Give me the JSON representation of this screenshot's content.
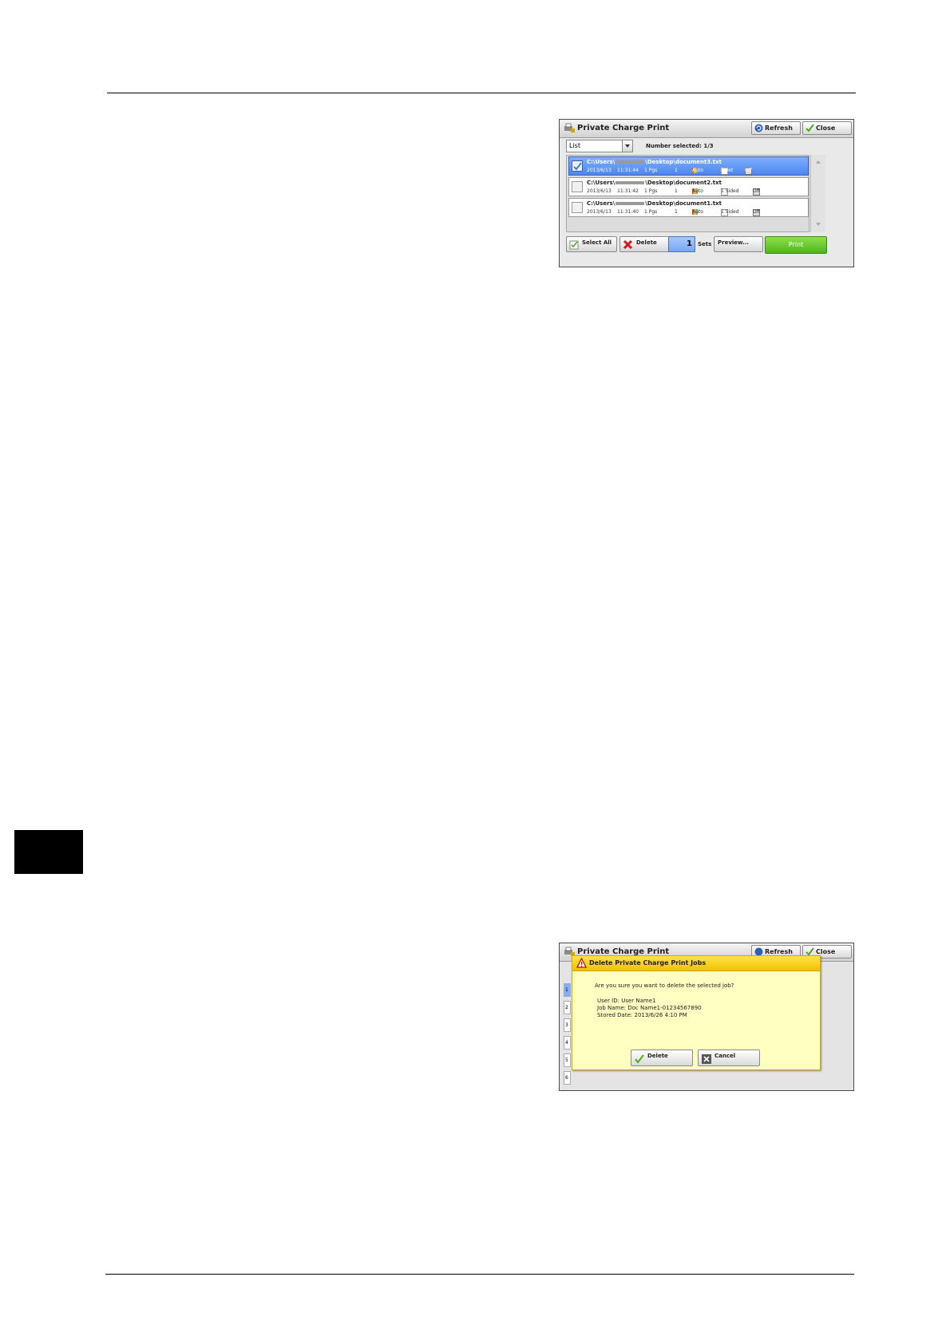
{
  "screen1": {
    "title": "Private Charge Print",
    "refresh_label": "Refresh",
    "close_label": "Close",
    "view_select": "List",
    "number_selected": "Number selected: 1/3",
    "jobs": [
      {
        "path_prefix": "C:\\Users\\",
        "path_suffix": "\\Desktop\\document3.txt",
        "date": "2013/6/13",
        "time": "11:31:44",
        "pages": "1 Pgs",
        "copies": "1",
        "color": "Auto",
        "sides": "Bklet",
        "staple": "Off",
        "selected": true
      },
      {
        "path_prefix": "C:\\Users\\",
        "path_suffix": "\\Desktop\\document2.txt",
        "date": "2013/6/13",
        "time": "11:31:42",
        "pages": "1 Pgs",
        "copies": "1",
        "color": "Auto",
        "sides": "1 Sided",
        "staple": "Off",
        "selected": false
      },
      {
        "path_prefix": "C:\\Users\\",
        "path_suffix": "\\Desktop\\document1.txt",
        "date": "2013/6/13",
        "time": "11:31:40",
        "pages": "1 Pgs",
        "copies": "1",
        "color": "Auto",
        "sides": "1 Sided",
        "staple": "Off",
        "selected": false
      }
    ],
    "select_all_label": "Select All",
    "delete_label": "Delete",
    "sets_value": "1",
    "sets_label": "Sets",
    "preview_label": "Preview...",
    "print_label": "Print"
  },
  "screen2": {
    "bg_title": "Private Charge Print",
    "bg_refresh": "Refresh",
    "bg_close": "Close",
    "bg_rows": [
      "1",
      "2",
      "3",
      "4",
      "5",
      "6"
    ],
    "dialog_title": "Delete Private Charge Print Jobs",
    "question": "Are you sure you want to delete the selected job?",
    "user_id": "User ID: User Name1",
    "job_name": "Job Name: Doc Name1-01234567890",
    "stored_date": "Stored Date: 2013/6/26 4:10 PM",
    "delete_label": "Delete",
    "cancel_label": "Cancel"
  }
}
